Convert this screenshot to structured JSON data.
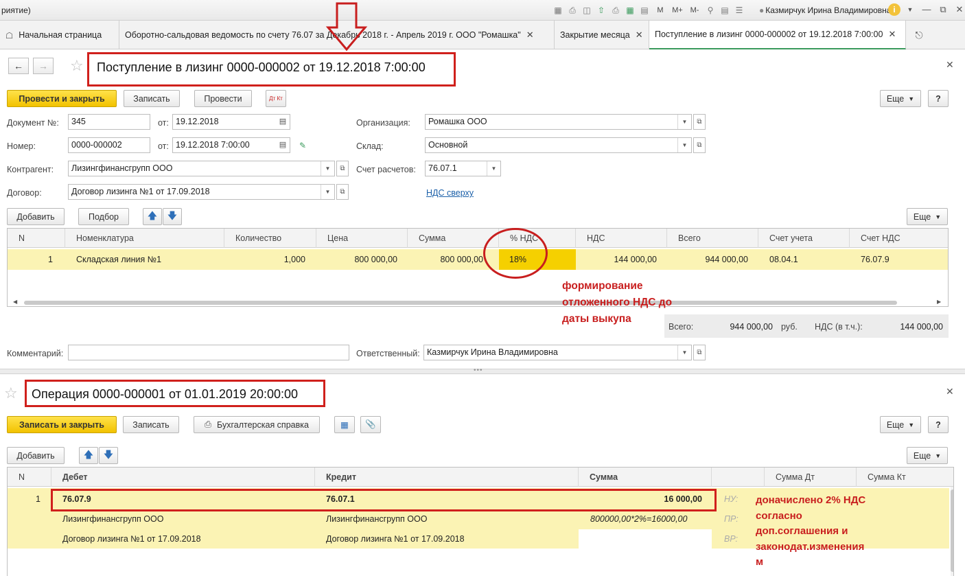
{
  "titlebar": {
    "app_title": "риятие)",
    "icons": [
      "save-icon",
      "print-icon",
      "preview-icon",
      "upload-icon",
      "print2-icon",
      "calc-icon",
      "calendar-icon"
    ],
    "memory": [
      "M",
      "M+",
      "M-"
    ],
    "user": "Казмирчук Ирина Владимировна"
  },
  "tabs": [
    {
      "label": "Начальная страница"
    },
    {
      "label": "Оборотно-сальдовая ведомость по счету 76.07 за Декабрь 2018 г. - Апрель 2019 г. ООО \"Ромашка\""
    },
    {
      "label": "Закрытие месяца"
    },
    {
      "label": "Поступление в лизинг 0000-000002 от 19.12.2018 7:00:00"
    }
  ],
  "doc1": {
    "title": "Поступление в лизинг 0000-000002 от 19.12.2018 7:00:00",
    "toolbar": {
      "post_close": "Провести и закрыть",
      "save": "Записать",
      "post": "Провести",
      "dtkt": "Дт Кт",
      "more": "Еще",
      "help": "?"
    },
    "fields": {
      "doc_no_label": "Документ №:",
      "doc_no": "345",
      "from_label": "от:",
      "doc_date": "19.12.2018",
      "number_label": "Номер:",
      "number": "0000-000002",
      "number_date": "19.12.2018  7:00:00",
      "contractor_label": "Контрагент:",
      "contractor": "Лизингфинансгрупп ООО",
      "contract_label": "Договор:",
      "contract": "Договор лизинга №1 от 17.09.2018",
      "org_label": "Организация:",
      "org": "Ромашка ООО",
      "warehouse_label": "Склад:",
      "warehouse": "Основной",
      "account_label": "Счет расчетов:",
      "account": "76.07.1",
      "vat_link": "НДС сверху"
    },
    "table_toolbar": {
      "add": "Добавить",
      "pick": "Подбор",
      "more": "Еще"
    },
    "table": {
      "headers": [
        "N",
        "Номенклатура",
        "Количество",
        "Цена",
        "Сумма",
        "% НДС",
        "НДС",
        "Всего",
        "Счет учета",
        "Счет НДС"
      ],
      "rows": [
        [
          "1",
          "Складская линия №1",
          "1,000",
          "800 000,00",
          "800 000,00",
          "18%",
          "144 000,00",
          "944 000,00",
          "08.04.1",
          "76.07.9"
        ]
      ]
    },
    "totals": {
      "total_label": "Всего:",
      "total": "944 000,00",
      "currency": "руб.",
      "vat_label": "НДС (в т.ч.):",
      "vat": "144 000,00"
    },
    "comment_label": "Комментарий:",
    "comment": "",
    "responsible_label": "Ответственный:",
    "responsible": "Казмирчук Ирина Владимировна",
    "annotation": [
      "формирование",
      "отложенного НДС до",
      "даты выкупа"
    ]
  },
  "doc2": {
    "title": "Операция 0000-000001 от 01.01.2019 20:00:00",
    "toolbar": {
      "save_close": "Записать и закрыть",
      "save": "Записать",
      "report": "Бухгалтерская справка",
      "more": "Еще",
      "help": "?"
    },
    "table_toolbar": {
      "add": "Добавить",
      "more": "Еще"
    },
    "table": {
      "headers": [
        "N",
        "Дебет",
        "Кредит",
        "Сумма",
        "",
        "Сумма Дт",
        "Сумма Кт"
      ],
      "row": {
        "n": "1",
        "debit": "76.07.9",
        "credit": "76.07.1",
        "sum": "16 000,00",
        "debit_sub1": "Лизингфинансгрупп ООО",
        "credit_sub1": "Лизингфинансгрупп ООО",
        "formula": "800000,00*2%=16000,00",
        "debit_sub2": "Договор лизинга №1 от 17.09.2018",
        "credit_sub2": "Договор лизинга №1 от 17.09.2018",
        "nu": "НУ:",
        "pr": "ПР:",
        "vr": "ВР:"
      }
    },
    "annotation": [
      "доначислено 2% НДС",
      "согласно",
      "доп.соглашения и",
      "законодат.изменения",
      "м"
    ]
  },
  "colors": {
    "accent_yellow": "#f2c200",
    "row_highlight": "#fbf3b4",
    "annotation_red": "#c81e1e",
    "link_blue": "#1a5fa8"
  }
}
